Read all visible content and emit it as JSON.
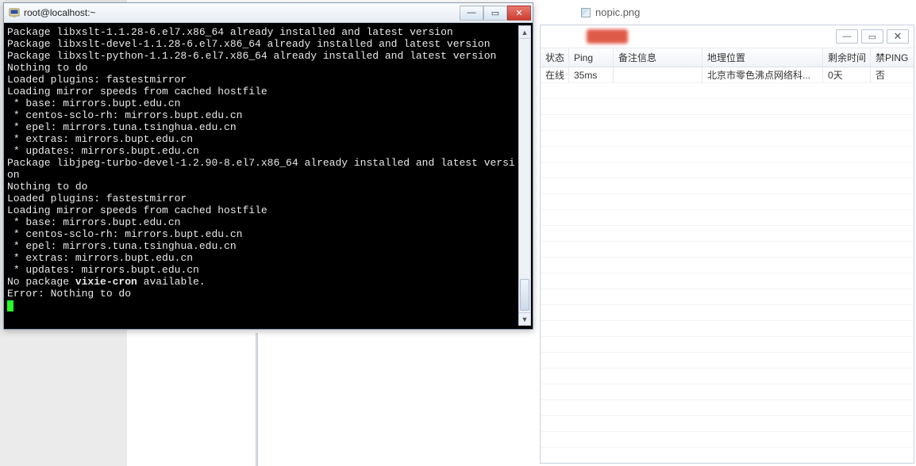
{
  "terminal": {
    "title": "root@localhost:~",
    "lines": [
      {
        "t": "Package libxslt-1.1.28-6.el7.x86_64 already installed and latest version"
      },
      {
        "t": "Package libxslt-devel-1.1.28-6.el7.x86_64 already installed and latest version"
      },
      {
        "t": "Package libxslt-python-1.1.28-6.el7.x86_64 already installed and latest version"
      },
      {
        "t": "Nothing to do"
      },
      {
        "t": "Loaded plugins: fastestmirror"
      },
      {
        "t": "Loading mirror speeds from cached hostfile"
      },
      {
        "t": " * base: mirrors.bupt.edu.cn"
      },
      {
        "t": " * centos-sclo-rh: mirrors.bupt.edu.cn"
      },
      {
        "t": " * epel: mirrors.tuna.tsinghua.edu.cn"
      },
      {
        "t": " * extras: mirrors.bupt.edu.cn"
      },
      {
        "t": " * updates: mirrors.bupt.edu.cn"
      },
      {
        "t": "Package libjpeg-turbo-devel-1.2.90-8.el7.x86_64 already installed and latest version"
      },
      {
        "t": "Nothing to do"
      },
      {
        "t": "Loaded plugins: fastestmirror"
      },
      {
        "t": "Loading mirror speeds from cached hostfile"
      },
      {
        "t": " * base: mirrors.bupt.edu.cn"
      },
      {
        "t": " * centos-sclo-rh: mirrors.bupt.edu.cn"
      },
      {
        "t": " * epel: mirrors.tuna.tsinghua.edu.cn"
      },
      {
        "t": " * extras: mirrors.bupt.edu.cn"
      },
      {
        "t": " * updates: mirrors.bupt.edu.cn"
      },
      {
        "pre": "No package ",
        "bold": "vixie-cron",
        "post": " available."
      },
      {
        "t": "Error: Nothing to do"
      }
    ]
  },
  "file_tab": {
    "label": "nopic.png"
  },
  "right_panel": {
    "headers": [
      "状态",
      "Ping",
      "备注信息",
      "地理位置",
      "剩余时间",
      "禁PING"
    ],
    "rows": [
      {
        "status": "在线",
        "ping": "35ms",
        "note": "",
        "geo": "北京市零色沸点网络科...",
        "remain": "0天",
        "noping": "否"
      }
    ],
    "empty_rows": 24
  },
  "win_btn": {
    "min": "—",
    "max": "▭",
    "close": "✕"
  }
}
